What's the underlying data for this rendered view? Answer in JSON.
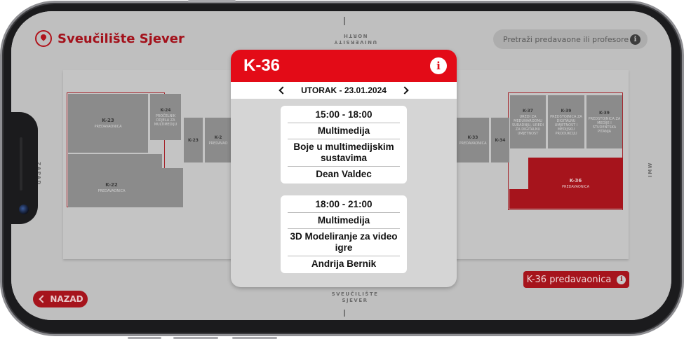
{
  "app": {
    "brand": "Sveučilište Sjever",
    "search_placeholder": "Pretraži predavaone ili profesore",
    "back_label": "NAZAD",
    "selected_room_label": "K-36 predavaonica"
  },
  "compass": {
    "north": "UNIVERSITY NORTH",
    "south": "SVEUČILIŠTE SJEVER",
    "west": "ZAPAD",
    "east": "IMW"
  },
  "rooms": [
    {
      "name": "K-23",
      "type": "PREDAVAONICA"
    },
    {
      "name": "K-24",
      "type": "PROČELNIK ODJELA ZA MULTIMEDIJU"
    },
    {
      "name": "K-23",
      "type": ""
    },
    {
      "name": "K-2",
      "type": "PREDAVAO"
    },
    {
      "name": "K-22",
      "type": "PREDAVAONICA"
    },
    {
      "name": "K-33",
      "type": "PREDAVAONICA"
    },
    {
      "name": "K-34",
      "type": ""
    },
    {
      "name": "K-37",
      "type": "UREDI ZA MEĐUNARODNU SURADNJU, UREDI ZA DIGITALNU UMJETNOST"
    },
    {
      "name": "K-39",
      "type": "PREDSTOJNICA ZA DIGITALNU UMJETNOST I MEDIJSKU PRODUKCIJU"
    },
    {
      "name": "K-39",
      "type": "PREDSTOJNICA ZA MEDIJE I STUDENTSKA PITANJA"
    },
    {
      "name": "K-36",
      "type": "PREDAVAONICA"
    }
  ],
  "modal": {
    "title": "K-36",
    "date": "UTORAK - 23.01.2024",
    "slots": [
      {
        "time": "15:00 - 18:00",
        "course": "Multimedija",
        "subject": "Boje u multimedijskim sustavima",
        "lecturer": "Dean Valdec"
      },
      {
        "time": "18:00 - 21:00",
        "course": "Multimedija",
        "subject": "3D Modeliranje za video igre",
        "lecturer": "Andrija Bernik"
      }
    ]
  },
  "icons": {
    "brand": "map-pin-icon",
    "info": "info-icon",
    "prev": "chevron-left-icon",
    "next": "chevron-right-icon",
    "back": "chevron-left-icon"
  },
  "colors": {
    "accent": "#e30b17",
    "selected_room": "#a6141c",
    "overlay_bg": "#bfbfbf"
  }
}
